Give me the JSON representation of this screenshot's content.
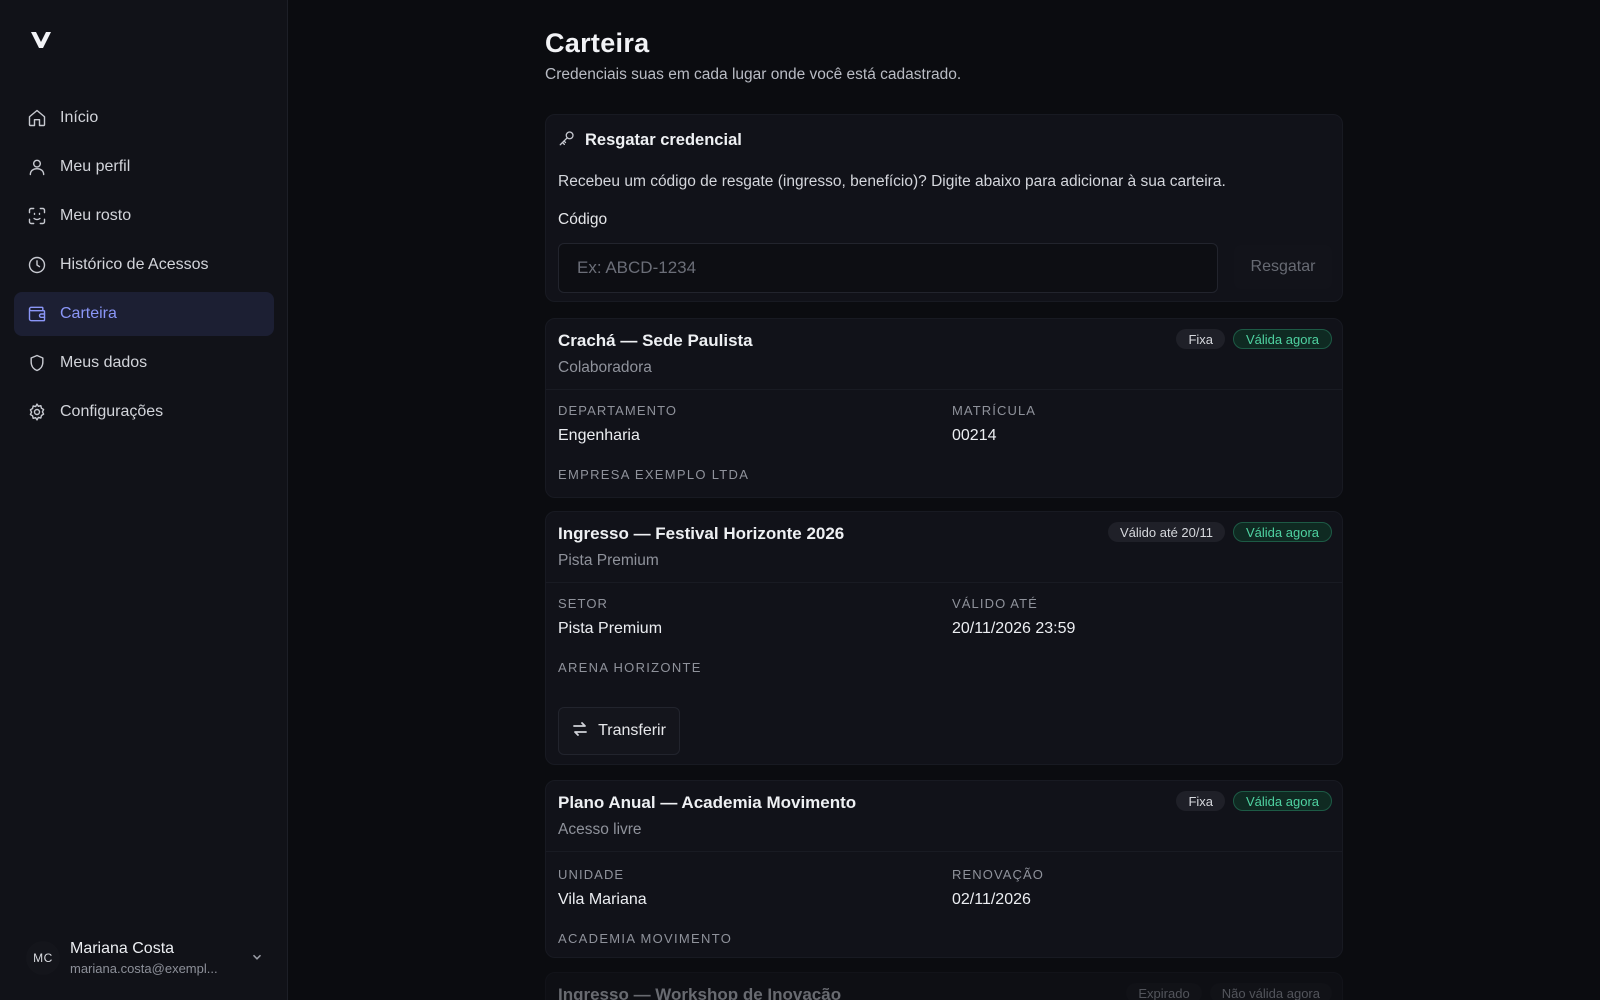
{
  "nav": [
    {
      "label": "Início",
      "icon": "home-icon"
    },
    {
      "label": "Meu perfil",
      "icon": "user-icon"
    },
    {
      "label": "Meu rosto",
      "icon": "face-scan-icon"
    },
    {
      "label": "Histórico de Acessos",
      "icon": "clock-icon"
    },
    {
      "label": "Carteira",
      "icon": "wallet-icon",
      "active": true
    },
    {
      "label": "Meus dados",
      "icon": "shield-icon"
    },
    {
      "label": "Configurações",
      "icon": "gear-icon"
    }
  ],
  "user": {
    "initials": "MC",
    "name": "Mariana Costa",
    "email": "mariana.costa@exempl..."
  },
  "page": {
    "title": "Carteira",
    "subtitle": "Credenciais suas em cada lugar onde você está cadastrado."
  },
  "redeem": {
    "title": "Resgatar credencial",
    "description": "Recebeu um código de resgate (ingresso, benefício)? Digite abaixo para adicionar à sua carteira.",
    "code_label": "Código",
    "placeholder": "Ex: ABCD-1234",
    "button": "Resgatar"
  },
  "credentials": [
    {
      "title": "Crachá — Sede Paulista",
      "subtitle": "Colaboradora",
      "badges": [
        "Fixa",
        "Válida agora"
      ],
      "fields": [
        {
          "label": "Departamento",
          "value": "Engenharia"
        },
        {
          "label": "Matrícula",
          "value": "00214"
        }
      ],
      "issuer": "Empresa Exemplo LTDA"
    },
    {
      "title": "Ingresso — Festival Horizonte 2026",
      "subtitle": "Pista Premium",
      "badges": [
        "Válido até 20/11",
        "Válida agora"
      ],
      "fields": [
        {
          "label": "Setor",
          "value": "Pista Premium"
        },
        {
          "label": "Válido até",
          "value": "20/11/2026 23:59"
        }
      ],
      "issuer": "Arena Horizonte",
      "action": "Transferir"
    },
    {
      "title": "Plano Anual — Academia Movimento",
      "subtitle": "Acesso livre",
      "badges": [
        "Fixa",
        "Válida agora"
      ],
      "fields": [
        {
          "label": "Unidade",
          "value": "Vila Mariana"
        },
        {
          "label": "Renovação",
          "value": "02/11/2026"
        }
      ],
      "issuer": "Academia Movimento"
    },
    {
      "title": "Ingresso — Workshop de Inovação",
      "badges": [
        "Expirado",
        "Não válida agora"
      ]
    }
  ],
  "colors": {
    "accent": "#8a96f7",
    "valid": "#4fd2a1",
    "background": "#0b0c10",
    "sidebar": "#111218"
  }
}
